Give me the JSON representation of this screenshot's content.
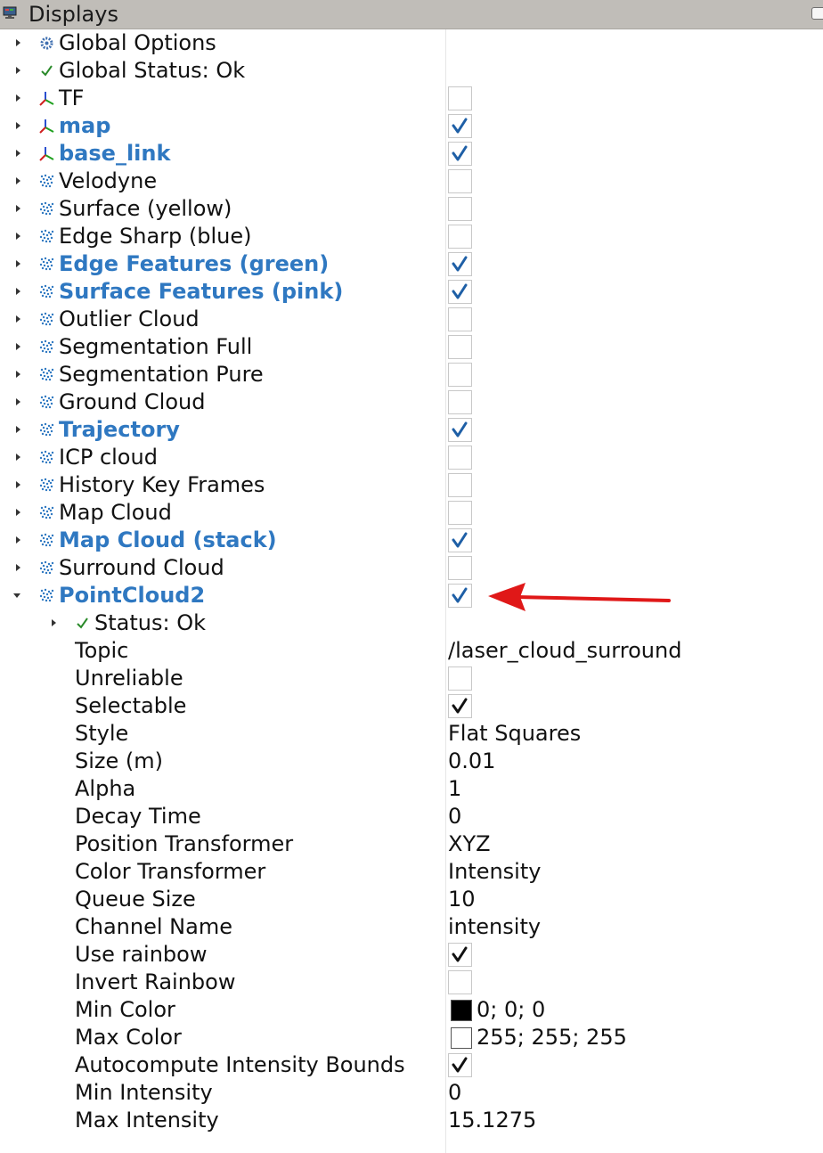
{
  "panel": {
    "title": "Displays",
    "title_icon": "monitor-icon",
    "float_button_icon": "float-window-icon"
  },
  "colors": {
    "titlebar_bg": "#c0bdb8",
    "enabled_label": "#2f78c1",
    "check_blue": "#1e5fa6",
    "check_black": "#111111",
    "red_arrow": "#e01818"
  },
  "displays": [
    {
      "label": "Global Options",
      "icon": "gear-icon",
      "enabled": null,
      "highlight": false
    },
    {
      "label": "Global Status: Ok",
      "icon": "check-icon",
      "enabled": null,
      "highlight": false
    },
    {
      "label": "TF",
      "icon": "axes-icon",
      "enabled": false,
      "highlight": false
    },
    {
      "label": "map",
      "icon": "axes-icon",
      "enabled": true,
      "highlight": true
    },
    {
      "label": "base_link",
      "icon": "axes-icon",
      "enabled": true,
      "highlight": true
    },
    {
      "label": "Velodyne",
      "icon": "pointcloud-icon",
      "enabled": false,
      "highlight": false
    },
    {
      "label": "Surface (yellow)",
      "icon": "pointcloud-icon",
      "enabled": false,
      "highlight": false
    },
    {
      "label": "Edge Sharp (blue)",
      "icon": "pointcloud-icon",
      "enabled": false,
      "highlight": false
    },
    {
      "label": "Edge Features (green)",
      "icon": "pointcloud-icon",
      "enabled": true,
      "highlight": true
    },
    {
      "label": "Surface Features (pink)",
      "icon": "pointcloud-icon",
      "enabled": true,
      "highlight": true
    },
    {
      "label": "Outlier Cloud",
      "icon": "pointcloud-icon",
      "enabled": false,
      "highlight": false
    },
    {
      "label": "Segmentation Full",
      "icon": "pointcloud-icon",
      "enabled": false,
      "highlight": false
    },
    {
      "label": "Segmentation Pure",
      "icon": "pointcloud-icon",
      "enabled": false,
      "highlight": false
    },
    {
      "label": "Ground Cloud",
      "icon": "pointcloud-icon",
      "enabled": false,
      "highlight": false
    },
    {
      "label": "Trajectory",
      "icon": "pointcloud-icon",
      "enabled": true,
      "highlight": true
    },
    {
      "label": "ICP cloud",
      "icon": "pointcloud-icon",
      "enabled": false,
      "highlight": false
    },
    {
      "label": "History Key Frames",
      "icon": "pointcloud-icon",
      "enabled": false,
      "highlight": false
    },
    {
      "label": "Map Cloud",
      "icon": "pointcloud-icon",
      "enabled": false,
      "highlight": false
    },
    {
      "label": "Map Cloud (stack)",
      "icon": "pointcloud-icon",
      "enabled": true,
      "highlight": true
    },
    {
      "label": "Surround Cloud",
      "icon": "pointcloud-icon",
      "enabled": false,
      "highlight": false
    },
    {
      "label": "PointCloud2",
      "icon": "pointcloud-icon",
      "enabled": true,
      "highlight": true,
      "expanded": true
    }
  ],
  "pointcloud2": {
    "status": {
      "label": "Status: Ok",
      "icon": "check-icon"
    },
    "properties": [
      {
        "label": "Topic",
        "type": "text",
        "value": "/laser_cloud_surround"
      },
      {
        "label": "Unreliable",
        "type": "checkbox",
        "checked": false
      },
      {
        "label": "Selectable",
        "type": "checkbox",
        "checked": true
      },
      {
        "label": "Style",
        "type": "text",
        "value": "Flat Squares"
      },
      {
        "label": "Size (m)",
        "type": "text",
        "value": "0.01"
      },
      {
        "label": "Alpha",
        "type": "text",
        "value": "1"
      },
      {
        "label": "Decay Time",
        "type": "text",
        "value": "0"
      },
      {
        "label": "Position Transformer",
        "type": "text",
        "value": "XYZ"
      },
      {
        "label": "Color Transformer",
        "type": "text",
        "value": "Intensity"
      },
      {
        "label": "Queue Size",
        "type": "text",
        "value": "10"
      },
      {
        "label": "Channel Name",
        "type": "text",
        "value": "intensity"
      },
      {
        "label": "Use rainbow",
        "type": "checkbox",
        "checked": true
      },
      {
        "label": "Invert Rainbow",
        "type": "checkbox",
        "checked": false
      },
      {
        "label": "Min Color",
        "type": "color",
        "value": "0; 0; 0",
        "swatch": "#000000"
      },
      {
        "label": "Max Color",
        "type": "color",
        "value": "255; 255; 255",
        "swatch": "#ffffff"
      },
      {
        "label": "Autocompute Intensity Bounds",
        "type": "checkbox",
        "checked": true
      },
      {
        "label": "Min Intensity",
        "type": "text",
        "value": "0"
      },
      {
        "label": "Max Intensity",
        "type": "text",
        "value": "15.1275"
      }
    ]
  },
  "annotation": {
    "icon": "red-arrow-icon",
    "points_to": "PointCloud2"
  }
}
